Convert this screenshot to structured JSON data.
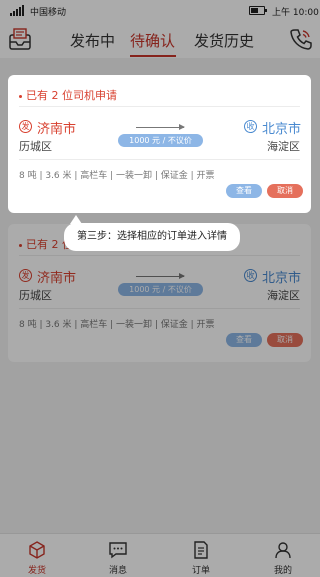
{
  "status_bar": {
    "carrier": "中国移动",
    "time": "上午 10:00"
  },
  "header": {
    "tabs": [
      {
        "label": "发布中",
        "active": false
      },
      {
        "label": "待确认",
        "active": true
      },
      {
        "label": "发货历史",
        "active": false
      }
    ],
    "left_icon": "inbox-icon",
    "right_icon": "phone-icon"
  },
  "orders": [
    {
      "badge": "已有 2 位司机申请",
      "from_icon_char": "发",
      "from_city": "济南市",
      "from_district": "历城区",
      "to_icon_char": "收",
      "to_city": "北京市",
      "to_district": "海淀区",
      "price": "1000 元 / 不议价",
      "specs": "8 吨 | 3.6 米 | 高栏车 | 一装一卸 | 保证金 | 开票",
      "view_label": "查看",
      "cancel_label": "取消"
    },
    {
      "badge": "已有 2 位司机申请",
      "from_icon_char": "发",
      "from_city": "济南市",
      "from_district": "历城区",
      "to_icon_char": "收",
      "to_city": "北京市",
      "to_district": "海淀区",
      "price": "1000 元 / 不议价",
      "specs": "8 吨 | 3.6 米 | 高栏车 | 一装一卸 | 保证金 | 开票",
      "view_label": "查看",
      "cancel_label": "取消"
    }
  ],
  "guide_tooltip": "第三步：选择相应的订单进入详情",
  "bottom_nav": [
    {
      "label": "发货",
      "icon": "package-icon",
      "active": true
    },
    {
      "label": "消息",
      "icon": "message-icon",
      "active": false
    },
    {
      "label": "订单",
      "icon": "document-icon",
      "active": false
    },
    {
      "label": "我的",
      "icon": "user-icon",
      "active": false
    }
  ],
  "colors": {
    "accent": "#c8352a",
    "blue": "#4a8ad0",
    "cancel": "#e5705c",
    "view": "#8db6e6"
  }
}
